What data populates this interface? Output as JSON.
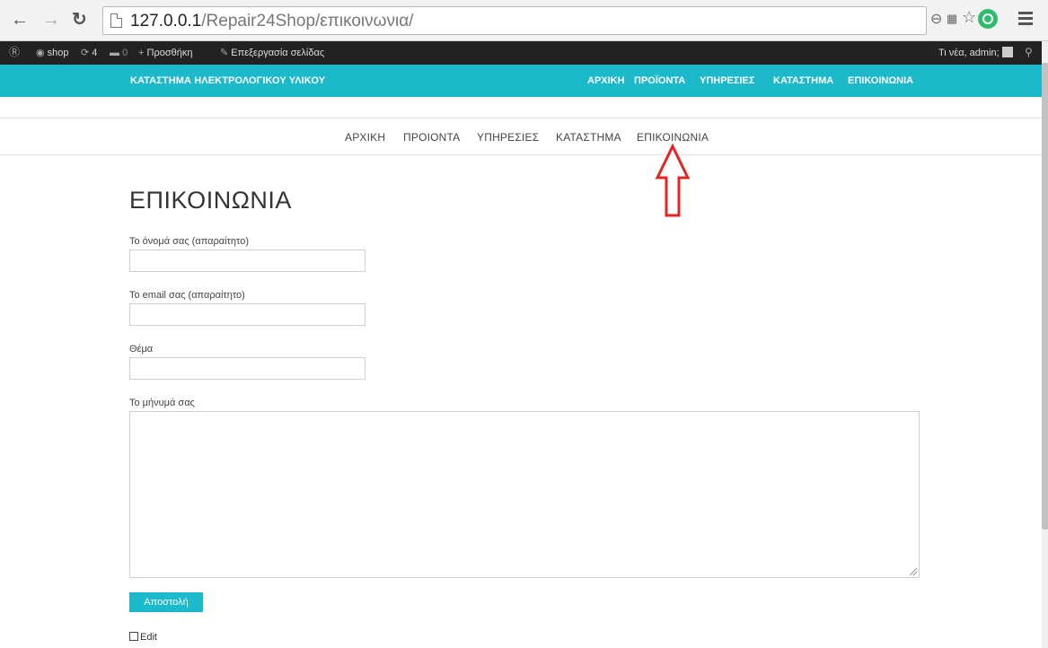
{
  "browser": {
    "url_host": "127.0.0.1",
    "url_path": "/Repair24Shop/επικοινωνια/"
  },
  "adminbar": {
    "site_name": "shop",
    "updates_count": "4",
    "comments_count": "0",
    "new_label": "Προσθήκη",
    "edit_page_label": "Επεξεργασία σελίδας",
    "howdy": "Τι νέα, admin;"
  },
  "site": {
    "brand": "ΚΑΤΑΣΤΗΜΑ ΗΛΕΚΤΡΟΛΟΓΙΚΟΥ ΥΛΙΚΟΥ",
    "accent_color": "#1bb9c9",
    "top_nav": [
      "ΑΡΧΙΚΗ",
      "ΠΡΟΪΟΝΤΑ",
      "ΥΠΗΡΕΣΙΕΣ",
      "ΚΑΤΑΣΤΗΜΑ",
      "ΕΠΙΚΟΙΝΩΝΙΑ"
    ],
    "sub_nav": [
      "ΑΡΧΙΚΗ",
      "ΠΡΟΙΟΝΤΑ",
      "ΥΠΗΡΕΣΙΕΣ",
      "ΚΑΤΑΣΤΗΜΑ",
      "ΕΠΙΚΟΙΝΩΝΙΑ"
    ]
  },
  "page": {
    "title": "ΕΠΙΚΟΙΝΩΝΙΑ",
    "form": {
      "name_label": "Το όνομά σας (απαραίτητο)",
      "email_label": "Το email σας (απαραίτητο)",
      "subject_label": "Θέμα",
      "message_label": "Το μήνυμά σας",
      "submit_label": "Αποστολή"
    },
    "edit_link": "Edit"
  }
}
